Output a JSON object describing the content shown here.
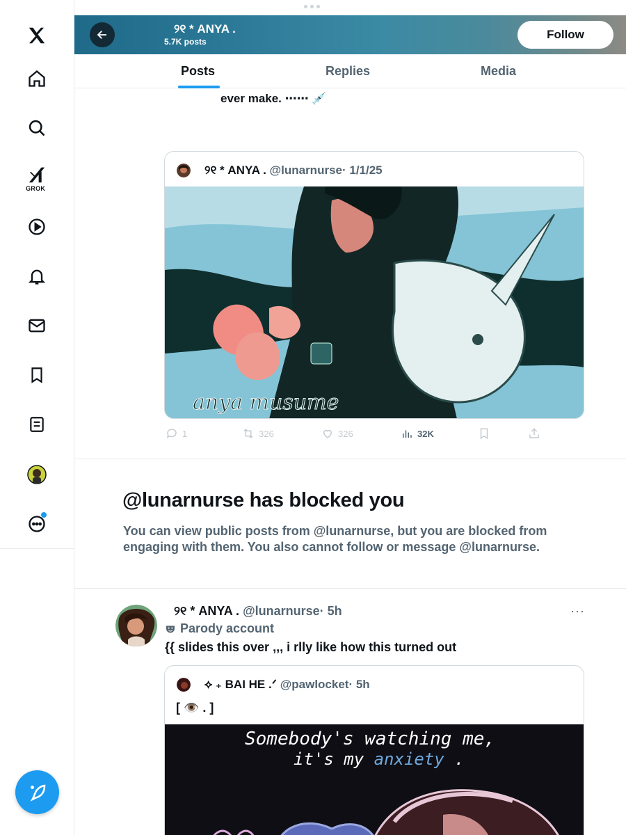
{
  "header": {
    "display_name": "୨୧   * ANYA   .",
    "post_count": "5.7K posts",
    "follow_label": "Follow"
  },
  "tabs": [
    {
      "label": "Posts",
      "active": true
    },
    {
      "label": "Replies",
      "active": false
    },
    {
      "label": "Media",
      "active": false
    }
  ],
  "remnant": {
    "text": "ever  make.  ⋯⋯  💉"
  },
  "quote1": {
    "name": "୨୧   * ANYA   .",
    "handle": "@lunarnurse",
    "date": "· 1/1/25",
    "image_text": "anya  musume"
  },
  "actions": {
    "replies": "1",
    "reposts": "326",
    "likes": "326",
    "views": "32K"
  },
  "blocked": {
    "title": "@lunarnurse has blocked you",
    "description": "You can view public posts from @lunarnurse, but you are blocked from engaging with them. You also cannot follow or message @lunarnurse."
  },
  "tweet2": {
    "name": "୨୧   * ANYA   .",
    "handle": "@lunarnurse",
    "time": "· 5h",
    "more": "···",
    "label": "Parody account",
    "text": "{{ slides this over ,,, i rlly like how this turned out"
  },
  "quote2": {
    "name": "⟡ ₊   BAI HE   .ᐟ",
    "handle": "@pawlocket",
    "time": "· 5h",
    "body": "[  👁️  .  ]",
    "image_line1": "Somebody's watching me,",
    "image_line2a": "it's  my ",
    "image_line2b": "anxiety",
    "image_line2c": " ."
  },
  "colors": {
    "accent": "#1d9bf0",
    "text_primary": "#0f1419",
    "text_secondary": "#536471",
    "border": "#cfd9de"
  }
}
